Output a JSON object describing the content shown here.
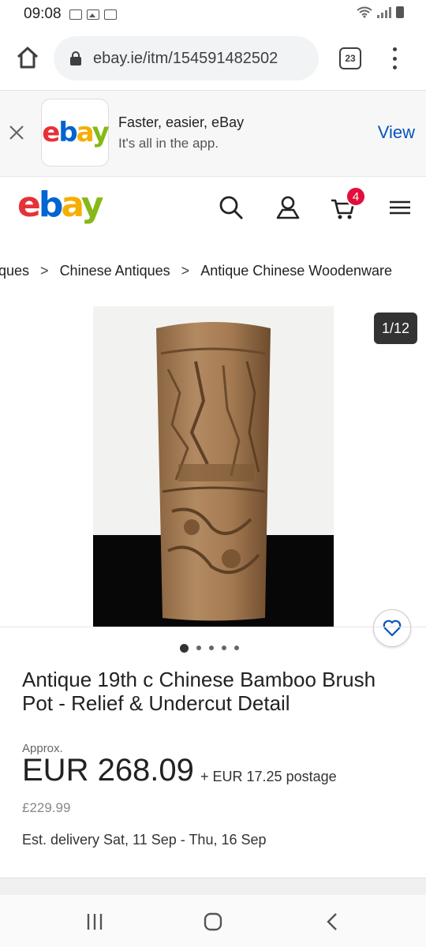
{
  "status_bar": {
    "time": "09:08"
  },
  "browser": {
    "url": "ebay.ie/itm/154591482502",
    "tab_count": "23"
  },
  "app_banner": {
    "title": "Faster, easier, eBay",
    "subtitle": "It's all in the app.",
    "view_label": "View"
  },
  "header": {
    "logo_letters": [
      "e",
      "b",
      "a",
      "y"
    ],
    "cart_count": "4"
  },
  "breadcrumb": {
    "items": [
      "ques",
      "Chinese Antiques",
      "Antique Chinese Woodenware"
    ],
    "separator": ">"
  },
  "gallery": {
    "counter": "1/12",
    "dot_count": 5
  },
  "item": {
    "title": "Antique 19th c Chinese Bamboo Brush Pot - Relief & Undercut Detail",
    "approx_label": "Approx.",
    "price": "EUR 268.09",
    "postage": "+ EUR 17.25 postage",
    "original_price": "£229.99",
    "delivery": "Est. delivery Sat, 11 Sep - Thu, 16 Sep"
  },
  "colors": {
    "ebay_red": "#e53238",
    "ebay_blue": "#0064d2",
    "ebay_yellow": "#f5af02",
    "ebay_green": "#86b817",
    "link_blue": "#0654ba",
    "badge_red": "#e0103a"
  }
}
